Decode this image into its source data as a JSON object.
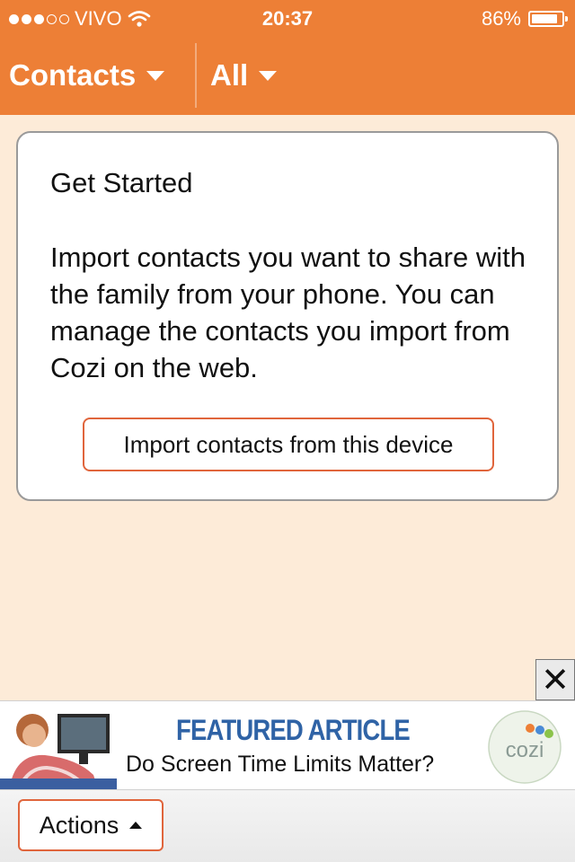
{
  "status_bar": {
    "carrier": "VIVO",
    "signal_bars_filled": 3,
    "signal_bars_total": 5,
    "time": "20:37",
    "battery_percent_label": "86%",
    "battery_level": 0.86
  },
  "nav": {
    "contacts_label": "Contacts",
    "filter_label": "All"
  },
  "card": {
    "title": "Get Started",
    "body": "Import contacts you want to share with the family from your phone. You can manage the contacts you import from Cozi on the web.",
    "import_button_label": "Import contacts from this device"
  },
  "ad": {
    "close_symbol": "✕",
    "headline": "FEATURED ARTICLE",
    "subheadline": "Do Screen Time Limits Matter?",
    "logo_text": "cozi"
  },
  "bottom_bar": {
    "actions_label": "Actions"
  },
  "colors": {
    "brand_orange": "#ed7f36",
    "page_background": "#fdebd8",
    "button_border": "#e0653c",
    "ad_headline": "#2f63a6"
  }
}
